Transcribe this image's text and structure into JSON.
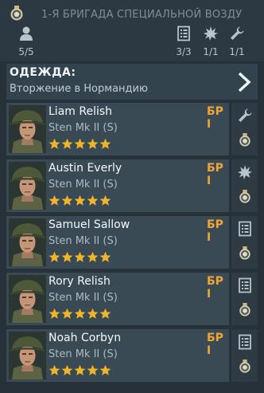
{
  "squad": {
    "title": "1-Я БРИГАДА СПЕЦИАЛЬНОЙ ВОЗДУ",
    "members": "5/5",
    "stat_orders": "3/3",
    "stat_explosives": "1/1",
    "stat_tools": "1/1"
  },
  "outfit": {
    "label": "ОДЕЖДА:",
    "value": "Вторжение в Нормандию"
  },
  "colors": {
    "rank": "#f0a534",
    "star": "#f0b429",
    "panel": "#3a4a55"
  },
  "soldiers": [
    {
      "name": "Liam Relish",
      "weapon": "Sten Mk II (S)",
      "rank": "БР I",
      "stars": 5,
      "role_icon": "wrench-icon"
    },
    {
      "name": "Austin Everly",
      "weapon": "Sten Mk II (S)",
      "rank": "БР I",
      "stars": 5,
      "role_icon": "explosion-icon"
    },
    {
      "name": "Samuel Sallow",
      "weapon": "Sten Mk II (S)",
      "rank": "БР I",
      "stars": 5,
      "role_icon": "orders-icon"
    },
    {
      "name": "Rory Relish",
      "weapon": "Sten Mk II (S)",
      "rank": "БР I",
      "stars": 5,
      "role_icon": "orders-icon"
    },
    {
      "name": "Noah Corbyn",
      "weapon": "Sten Mk II (S)",
      "rank": "БР I",
      "stars": 5,
      "role_icon": "orders-icon"
    }
  ]
}
